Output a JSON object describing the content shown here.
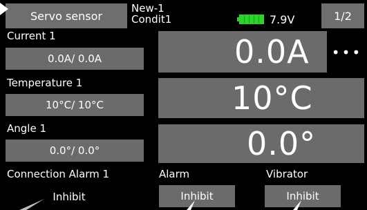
{
  "header": {
    "title_button": "Servo sensor",
    "model_name": "New-1",
    "condition": "Condit1",
    "battery_voltage": "7.9V",
    "page_indicator": "1/2"
  },
  "sections": {
    "current": {
      "label": "Current 1",
      "small_value": "0.0A/  0.0A",
      "big_value": "0.0A"
    },
    "temperature": {
      "label": "Temperature 1",
      "small_value": "10°C/  10°C",
      "big_value": "10°C"
    },
    "angle": {
      "label": "Angle 1",
      "small_value": "0.0°/   0.0°",
      "big_value": "0.0°"
    }
  },
  "connection_alarm": {
    "label": "Connection Alarm 1",
    "value": "Inhibit",
    "alarm_label": "Alarm",
    "alarm_value": "Inhibit",
    "vibrator_label": "Vibrator",
    "vibrator_value": "Inhibit"
  },
  "more_button_glyph": "•••",
  "colors": {
    "battery": "#2fd12f",
    "panel": "#6b6b6b",
    "background": "#000000"
  }
}
